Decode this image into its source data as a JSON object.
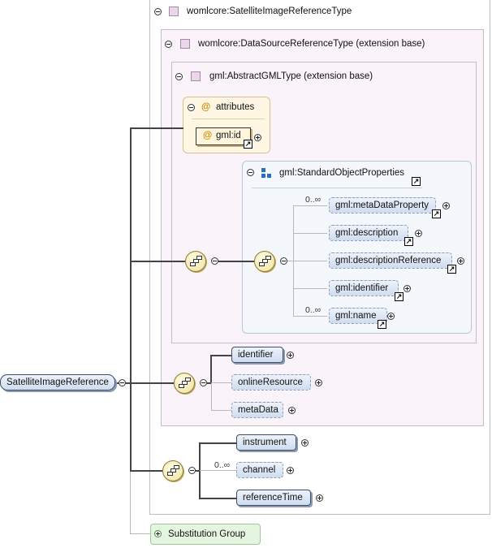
{
  "root": {
    "label": "SatelliteImageReference"
  },
  "outer_type": {
    "label": "womlcore:SatelliteImageReferenceType"
  },
  "ext_type": {
    "label": "womlcore:DataSourceReferenceType (extension base)"
  },
  "gml_type": {
    "label": "gml:AbstractGMLType (extension base)"
  },
  "attributes": {
    "header": "attributes",
    "attr_label": "gml:id",
    "at": "@"
  },
  "std_props": {
    "label": "gml:StandardObjectProperties",
    "items": [
      {
        "label": "gml:metaDataProperty",
        "cardinality": "0..∞"
      },
      {
        "label": "gml:description",
        "cardinality": ""
      },
      {
        "label": "gml:descriptionReference",
        "cardinality": ""
      },
      {
        "label": "gml:identifier",
        "cardinality": ""
      },
      {
        "label": "gml:name",
        "cardinality": "0..∞"
      }
    ]
  },
  "datasource_seq": {
    "items": [
      {
        "label": "identifier"
      },
      {
        "label": "onlineResource"
      },
      {
        "label": "metaData"
      }
    ]
  },
  "satellite_seq": {
    "items": [
      {
        "label": "instrument",
        "cardinality": ""
      },
      {
        "label": "channel",
        "cardinality": "0..∞"
      },
      {
        "label": "referenceTime",
        "cardinality": ""
      }
    ]
  },
  "substitution": {
    "label": "Substitution Group"
  },
  "colors": {
    "type_border": "#bdbdbd",
    "ext_bg": "#faf3fa",
    "attr_bg": "#fff6e3",
    "element_fill": "#cfdcef",
    "seq_fill": "#efe1a0",
    "subst_bg": "#e4f6e0"
  }
}
